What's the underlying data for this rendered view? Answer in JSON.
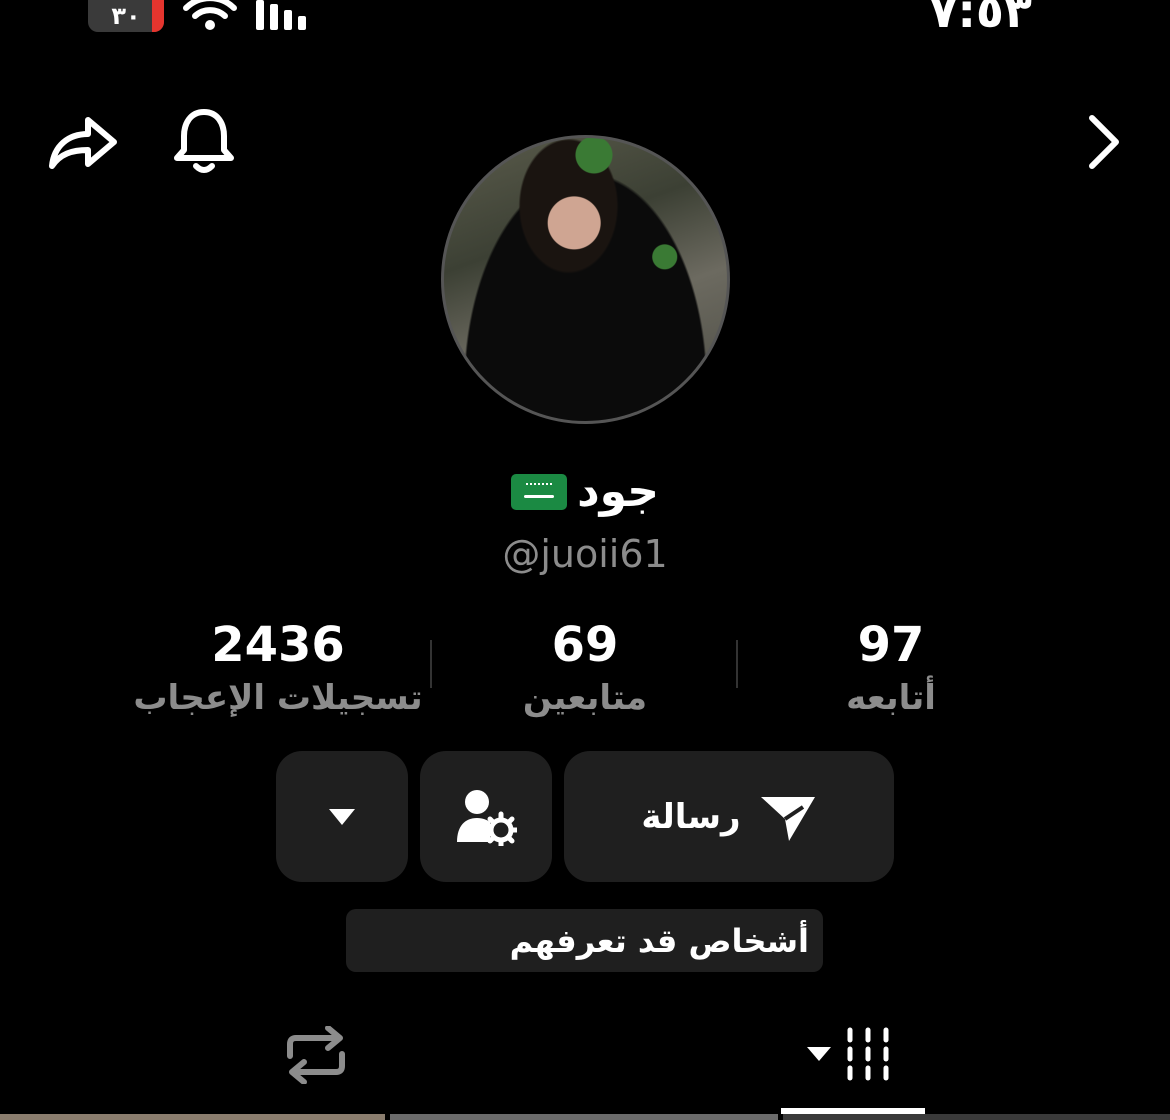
{
  "status_bar": {
    "battery_level": "٣٠",
    "time": "٧:٥٣",
    "battery_color": "#e5352e"
  },
  "nav": {
    "share_icon": "share-arrow-icon",
    "bell_icon": "bell-icon",
    "back_icon": "chevron-right-icon"
  },
  "profile": {
    "display_name": "جود",
    "flag": "saudi-flag",
    "username": "@juoii61"
  },
  "stats": {
    "following": {
      "value": "97",
      "label": "أتابعه"
    },
    "followers": {
      "value": "69",
      "label": "متابعين"
    },
    "likes": {
      "value": "2436",
      "label": "تسجيلات الإعجاب"
    }
  },
  "actions": {
    "message_label": "رسالة",
    "suggest_label": "أشخاص قد تعرفهم"
  },
  "tabs": {
    "repost_icon": "repost-icon",
    "grid_icon": "grid-icon"
  }
}
